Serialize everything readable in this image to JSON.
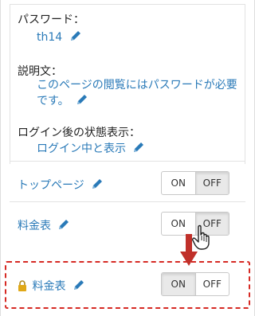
{
  "settings": {
    "password_label": "パスワード：",
    "password_value": "th14",
    "description_label": "説明文：",
    "description_value_line1": "このページの閲覧にはパスワードが必要",
    "description_value_line2": "です。",
    "status_label": "ログイン後の状態表示：",
    "status_value": "ログイン中と表示"
  },
  "rows": [
    {
      "label": "トップページ",
      "on": "ON",
      "off": "OFF",
      "active": "off",
      "locked": false
    },
    {
      "label": "料金表",
      "on": "ON",
      "off": "OFF",
      "active": "off",
      "locked": false
    },
    {
      "label": "料金表",
      "on": "ON",
      "off": "OFF",
      "active": "on",
      "locked": true
    }
  ],
  "colors": {
    "link": "#2a7ab8",
    "annotation": "#d62a24",
    "lock": "#e0a817"
  },
  "icons": {
    "edit": "pencil-icon",
    "lock": "lock-icon",
    "pointer": "hand-pointer-icon",
    "arrow": "arrow-down-icon"
  }
}
